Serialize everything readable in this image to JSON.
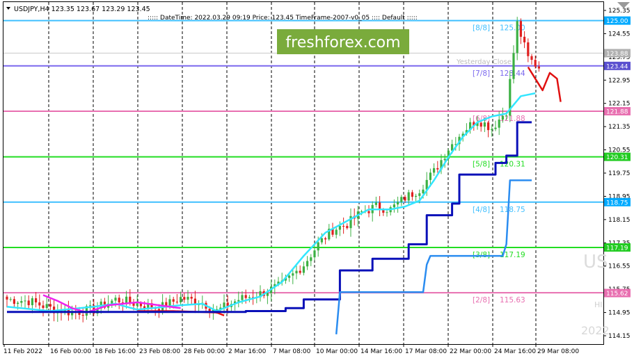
{
  "header": {
    "symbol_line": "USDJPY,H4  123.35 123.67 123.29 123.45",
    "info_line": "::::: DateTime: 2022.03.29 09:19    Price: 123.45    TimeFrame-2007-v0_05  ::::  Default  :::::"
  },
  "logo": {
    "text": "freshforex.com",
    "bg": "#7aab3c",
    "fg": "#ffffff"
  },
  "watermark": {
    "symbol": "US",
    "hi": "HI",
    "year": "2022"
  },
  "yesterday_close_label": "Yesterday Close",
  "chart_data": {
    "type": "candlestick",
    "ylim": [
      114.15,
      125.35
    ],
    "y_ticks": [
      "125.35",
      "124.55",
      "123.75",
      "122.95",
      "122.15",
      "121.35",
      "120.55",
      "119.75",
      "118.95",
      "118.15",
      "117.35",
      "116.55",
      "115.75",
      "114.95",
      "114.15"
    ],
    "x_ticks": [
      "11 Feb 2022",
      "16 Feb 00:00",
      "18 Feb 16:00",
      "23 Feb 08:00",
      "28 Feb 00:00",
      "2 Mar 16:00",
      "7 Mar 08:00",
      "10 Mar 00:00",
      "14 Mar 16:00",
      "17 Mar 08:00",
      "22 Mar 00:00",
      "24 Mar 16:00",
      "29 Mar 08:00"
    ],
    "murrey_levels": [
      {
        "label": "[8/8]",
        "value": 125.0,
        "text": "125.00",
        "color": "#3fbfff"
      },
      {
        "label": "[7/8]",
        "value": 123.44,
        "text": "123.44",
        "color": "#7b68ee"
      },
      {
        "label": "[6/8]",
        "value": 121.88,
        "text": "121.88",
        "color": "#e86fb0"
      },
      {
        "label": "[5/8]",
        "value": 120.31,
        "text": "120.31",
        "color": "#22dd22"
      },
      {
        "label": "[4/8]",
        "value": 118.75,
        "text": "118.75",
        "color": "#3fbfff"
      },
      {
        "label": "[3/8]",
        "value": 117.19,
        "text": "117.19",
        "color": "#22dd22"
      },
      {
        "label": "[2/8]",
        "value": 115.63,
        "text": "115.63",
        "color": "#e86fb0"
      }
    ],
    "price_tags": [
      {
        "value": 125.0,
        "text": "125.00",
        "color": "#00aaff"
      },
      {
        "value": 123.88,
        "text": "123.88",
        "color": "#b0b0b0"
      },
      {
        "value": 123.44,
        "text": "123.44",
        "color": "#5a4fcf"
      },
      {
        "value": 121.88,
        "text": "121.88",
        "color": "#e86fb0"
      },
      {
        "value": 120.31,
        "text": "120.31",
        "color": "#22cc22"
      },
      {
        "value": 118.75,
        "text": "118.75",
        "color": "#00aaff"
      },
      {
        "value": 117.19,
        "text": "117.19",
        "color": "#22cc22"
      },
      {
        "value": 115.62,
        "text": "115.62",
        "color": "#e86fb0"
      }
    ],
    "yesterday_close": 123.88,
    "up_color": "#3cb043",
    "down_color": "#e02020",
    "trend_nodes": [
      [
        0,
        115.4
      ],
      [
        6,
        115.35
      ],
      [
        12,
        115.1
      ],
      [
        18,
        114.95
      ],
      [
        24,
        115.05
      ],
      [
        30,
        115.4
      ],
      [
        36,
        115.25
      ],
      [
        42,
        115.1
      ],
      [
        48,
        115.45
      ],
      [
        54,
        115.3
      ],
      [
        58,
        115.0
      ],
      [
        64,
        115.4
      ],
      [
        70,
        115.6
      ],
      [
        76,
        115.9
      ],
      [
        82,
        116.6
      ],
      [
        86,
        117.3
      ],
      [
        90,
        117.8
      ],
      [
        94,
        118.0
      ],
      [
        98,
        118.4
      ],
      [
        102,
        118.6
      ],
      [
        106,
        118.5
      ],
      [
        110,
        118.9
      ],
      [
        114,
        119.2
      ],
      [
        118,
        119.8
      ],
      [
        122,
        120.6
      ],
      [
        126,
        121.2
      ],
      [
        130,
        121.6
      ],
      [
        134,
        121.3
      ],
      [
        138,
        121.9
      ],
      [
        141,
        124.9
      ],
      [
        144,
        123.7
      ],
      [
        147,
        123.4
      ]
    ],
    "cyan_line": [
      [
        0,
        115.15
      ],
      [
        12,
        115.0
      ],
      [
        24,
        115.15
      ],
      [
        30,
        115.25
      ],
      [
        36,
        115.05
      ],
      [
        48,
        115.2
      ],
      [
        54,
        115.25
      ],
      [
        58,
        115.0
      ],
      [
        64,
        115.3
      ],
      [
        70,
        115.5
      ],
      [
        76,
        116.0
      ],
      [
        82,
        116.9
      ],
      [
        88,
        117.7
      ],
      [
        94,
        118.1
      ],
      [
        100,
        118.5
      ],
      [
        106,
        118.5
      ],
      [
        110,
        118.6
      ],
      [
        114,
        118.8
      ],
      [
        118,
        119.5
      ],
      [
        122,
        120.3
      ],
      [
        126,
        121.0
      ],
      [
        130,
        121.5
      ],
      [
        134,
        121.7
      ],
      [
        138,
        121.8
      ],
      [
        142,
        122.4
      ],
      [
        146,
        122.5
      ]
    ],
    "magenta_line": [
      [
        10,
        115.55
      ],
      [
        14,
        115.35
      ],
      [
        18,
        115.1
      ],
      [
        22,
        114.95
      ],
      [
        28,
        115.2
      ],
      [
        36,
        115.3
      ],
      [
        42,
        115.2
      ],
      [
        48,
        115.1
      ]
    ],
    "red_line": [
      [
        36,
        115.0
      ],
      [
        46,
        115.0
      ],
      [
        58,
        114.95
      ],
      [
        60,
        114.85
      ]
    ],
    "dark_blue_steps": [
      [
        0,
        114.97
      ],
      [
        66,
        114.97
      ],
      [
        66,
        115.0
      ],
      [
        77,
        115.0
      ],
      [
        77,
        115.1
      ],
      [
        82,
        115.1
      ],
      [
        82,
        115.4
      ],
      [
        92,
        115.4
      ],
      [
        92,
        116.4
      ],
      [
        101,
        116.4
      ],
      [
        101,
        116.8
      ],
      [
        111,
        116.8
      ],
      [
        111,
        117.3
      ],
      [
        116,
        117.3
      ],
      [
        116,
        118.3
      ],
      [
        123,
        118.3
      ],
      [
        123,
        118.7
      ],
      [
        125,
        118.7
      ],
      [
        125,
        119.7
      ],
      [
        135,
        119.7
      ],
      [
        135,
        120.1
      ],
      [
        138,
        120.1
      ],
      [
        138,
        120.35
      ],
      [
        141,
        120.35
      ],
      [
        141,
        121.5
      ],
      [
        145,
        121.5
      ]
    ],
    "blue_steps": [
      [
        91,
        114.2
      ],
      [
        92,
        115.65
      ],
      [
        115,
        115.65
      ],
      [
        116,
        116.6
      ],
      [
        117,
        116.9
      ],
      [
        137,
        116.9
      ],
      [
        138,
        117.3
      ],
      [
        139,
        119.5
      ],
      [
        145,
        119.5
      ]
    ],
    "forecast": [
      [
        144,
        123.4
      ],
      [
        146,
        123.0
      ],
      [
        148,
        122.6
      ],
      [
        150,
        123.2
      ],
      [
        152,
        123.0
      ],
      [
        153,
        122.2
      ]
    ]
  }
}
